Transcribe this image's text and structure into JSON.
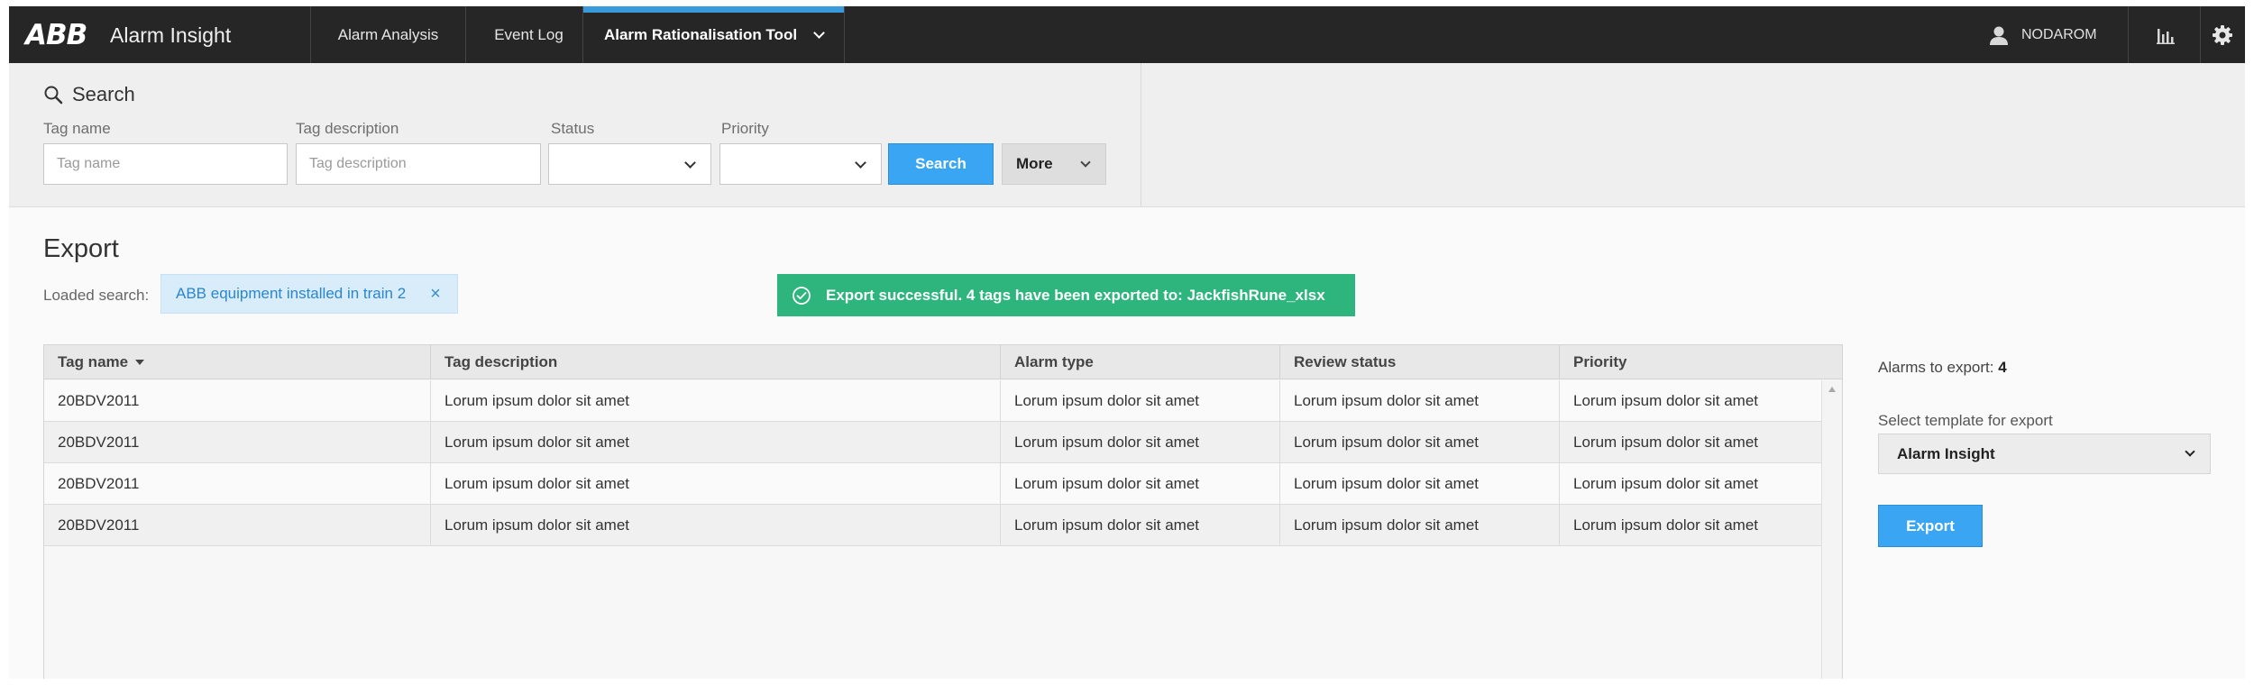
{
  "header": {
    "logo": "ABB",
    "app_name": "Alarm Insight",
    "nav": [
      {
        "label": "Alarm Analysis"
      },
      {
        "label": "Event Log"
      },
      {
        "label": "Alarm Rationalisation Tool",
        "active": true
      }
    ],
    "user": "NODAROM",
    "accent_color": "#3a9bdc"
  },
  "search": {
    "title": "Search",
    "tag_name": {
      "label": "Tag name",
      "placeholder": "Tag name",
      "value": ""
    },
    "tag_description": {
      "label": "Tag description",
      "placeholder": "Tag description",
      "value": ""
    },
    "status": {
      "label": "Status",
      "value": ""
    },
    "priority": {
      "label": "Priority",
      "value": ""
    },
    "search_button": "Search",
    "more_button": "More"
  },
  "export": {
    "title": "Export",
    "loaded_label": "Loaded search:",
    "loaded_chip": "ABB equipment installed in train 2",
    "toast": "Export successful. 4 tags have been exported to: JackfishRune_xlsx",
    "toast_color": "#2db57d"
  },
  "table": {
    "columns": [
      "Tag name",
      "Tag description",
      "Alarm type",
      "Review status",
      "Priority"
    ],
    "sort_column": "Tag name",
    "rows": [
      [
        "20BDV2011",
        "Lorum ipsum dolor sit amet",
        "Lorum ipsum dolor sit amet",
        "Lorum ipsum dolor sit amet",
        "Lorum ipsum dolor sit amet"
      ],
      [
        "20BDV2011",
        "Lorum ipsum dolor sit amet",
        "Lorum ipsum dolor sit amet",
        "Lorum ipsum dolor sit amet",
        "Lorum ipsum dolor sit amet"
      ],
      [
        "20BDV2011",
        "Lorum ipsum dolor sit amet",
        "Lorum ipsum dolor sit amet",
        "Lorum ipsum dolor sit amet",
        "Lorum ipsum dolor sit amet"
      ],
      [
        "20BDV2011",
        "Lorum ipsum dolor sit amet",
        "Lorum ipsum dolor sit amet",
        "Lorum ipsum dolor sit amet",
        "Lorum ipsum dolor sit amet"
      ]
    ]
  },
  "side": {
    "alarms_label": "Alarms to export:",
    "alarms_count": "4",
    "template_label": "Select template for export",
    "template_value": "Alarm Insight",
    "export_button": "Export",
    "button_color": "#3aa6f3"
  },
  "icons": [
    "search-icon",
    "user-icon",
    "chart-icon",
    "gear-icon",
    "check-circle-icon",
    "close-icon",
    "chevron-down-icon",
    "sort-down-icon"
  ]
}
